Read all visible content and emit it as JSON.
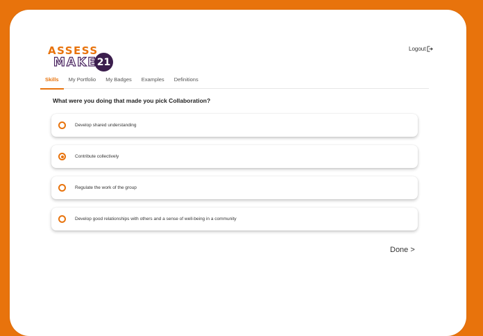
{
  "logo": {
    "line1": "ASSESS",
    "line2": "MAKE",
    "badge": "21"
  },
  "header": {
    "logout_label": "Logout"
  },
  "tabs": [
    {
      "label": "Skills",
      "active": true
    },
    {
      "label": "My Portfolio",
      "active": false
    },
    {
      "label": "My Badges",
      "active": false
    },
    {
      "label": "Examples",
      "active": false
    },
    {
      "label": "Definitions",
      "active": false
    }
  ],
  "question": "What were you doing that made you pick Collaboration?",
  "options": [
    {
      "label": "Develop shared understanding",
      "selected": false
    },
    {
      "label": "Contribute collectively",
      "selected": true
    },
    {
      "label": "Regulate the work of the group",
      "selected": false
    },
    {
      "label": "Develop good relationships with others and a sense of well-being in a community",
      "selected": false
    }
  ],
  "done_label": "Done >",
  "colors": {
    "accent": "#e8730c",
    "brand_dark": "#3b1e4d",
    "background": "#e8730c"
  }
}
